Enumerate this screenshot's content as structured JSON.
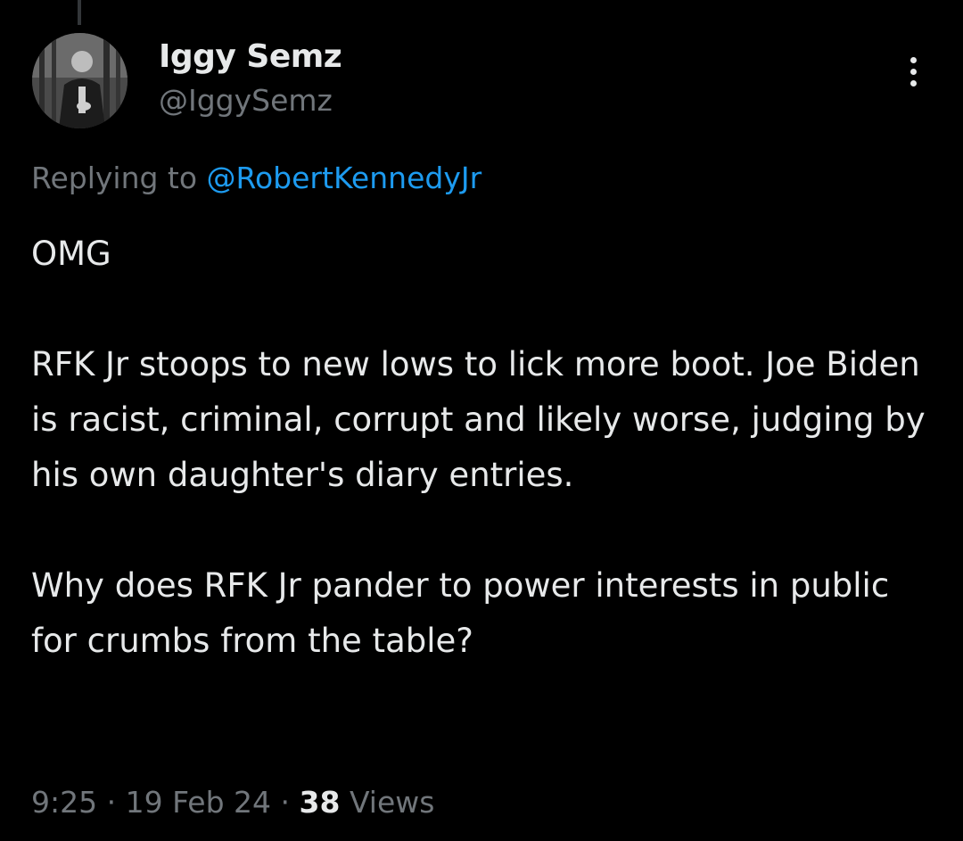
{
  "author": {
    "name": "Iggy Semz",
    "handle": "@IggySemz"
  },
  "reply": {
    "prefix": "Replying to",
    "target": "@RobertKennedyJr"
  },
  "tweet": {
    "paragraphs": [
      "OMG",
      "RFK Jr stoops to new lows to lick more boot. Joe Biden is racist, criminal, corrupt and likely worse, judging by his own daughter's diary entries.",
      "Why does RFK Jr pander to power interests in public for crumbs from the table?"
    ]
  },
  "meta": {
    "time": "9:25",
    "separator": "·",
    "date": "19 Feb 24",
    "views_count": "38",
    "views_label": "Views"
  },
  "icons": {
    "more": "more-vertical-icon"
  },
  "colors": {
    "background": "#000000",
    "text_primary": "#e7e9ea",
    "text_secondary": "#71767b",
    "link": "#1d9bf0"
  }
}
